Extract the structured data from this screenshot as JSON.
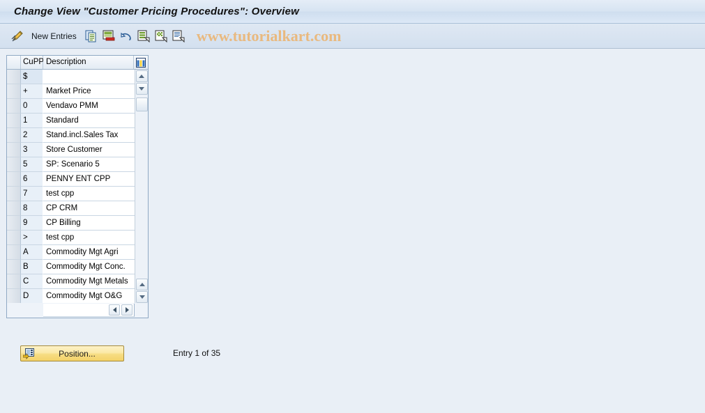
{
  "window": {
    "title": "Change View \"Customer Pricing Procedures\": Overview"
  },
  "toolbar": {
    "display_change_icon": "pencil-toggle-icon",
    "new_entries_label": "New Entries",
    "buttons": [
      {
        "icon": "copy-icon",
        "name": "copy-as-button"
      },
      {
        "icon": "delete-icon",
        "name": "delete-button"
      },
      {
        "icon": "undo-icon",
        "name": "undo-button"
      },
      {
        "icon": "select-all-icon",
        "name": "select-all-button"
      },
      {
        "icon": "deselect-all-icon",
        "name": "deselect-all-button"
      },
      {
        "icon": "variant-icon",
        "name": "select-layout-button"
      }
    ],
    "watermark": "www.tutorialkart.com"
  },
  "table": {
    "columns": [
      "CuPP",
      "Description"
    ],
    "config_icon": "column-settings-icon",
    "rows": [
      {
        "cupp": "$",
        "description": ""
      },
      {
        "cupp": "+",
        "description": "Market Price"
      },
      {
        "cupp": "0",
        "description": "Vendavo PMM"
      },
      {
        "cupp": "1",
        "description": "Standard"
      },
      {
        "cupp": "2",
        "description": "Stand.incl.Sales Tax"
      },
      {
        "cupp": "3",
        "description": "Store Customer"
      },
      {
        "cupp": "5",
        "description": "SP: Scenario 5"
      },
      {
        "cupp": "6",
        "description": "PENNY ENT CPP"
      },
      {
        "cupp": "7",
        "description": "test cpp"
      },
      {
        "cupp": "8",
        "description": "CP CRM"
      },
      {
        "cupp": "9",
        "description": "CP Billing"
      },
      {
        "cupp": ">",
        "description": "test cpp"
      },
      {
        "cupp": "A",
        "description": "Commodity Mgt Agri"
      },
      {
        "cupp": "B",
        "description": "Commodity Mgt Conc."
      },
      {
        "cupp": "C",
        "description": "Commodity Mgt Metals"
      },
      {
        "cupp": "D",
        "description": "Commodity Mgt O&G"
      }
    ],
    "scroll": {
      "up_icon": "scroll-up-icon",
      "down_icon": "scroll-down-icon",
      "left_icon": "scroll-left-icon",
      "right_icon": "scroll-right-icon"
    }
  },
  "footer": {
    "position_button_label": "Position...",
    "position_button_icon": "position-icon",
    "entry_status": "Entry 1 of 35"
  },
  "colors": {
    "page_background": "#e9eff6",
    "title_bar": "#d7e4f2",
    "toolbar": "#d9e4f0",
    "watermark": "#e9b97f",
    "button_yellow": "#f7dd84",
    "panel_border": "#8fa9c4"
  }
}
